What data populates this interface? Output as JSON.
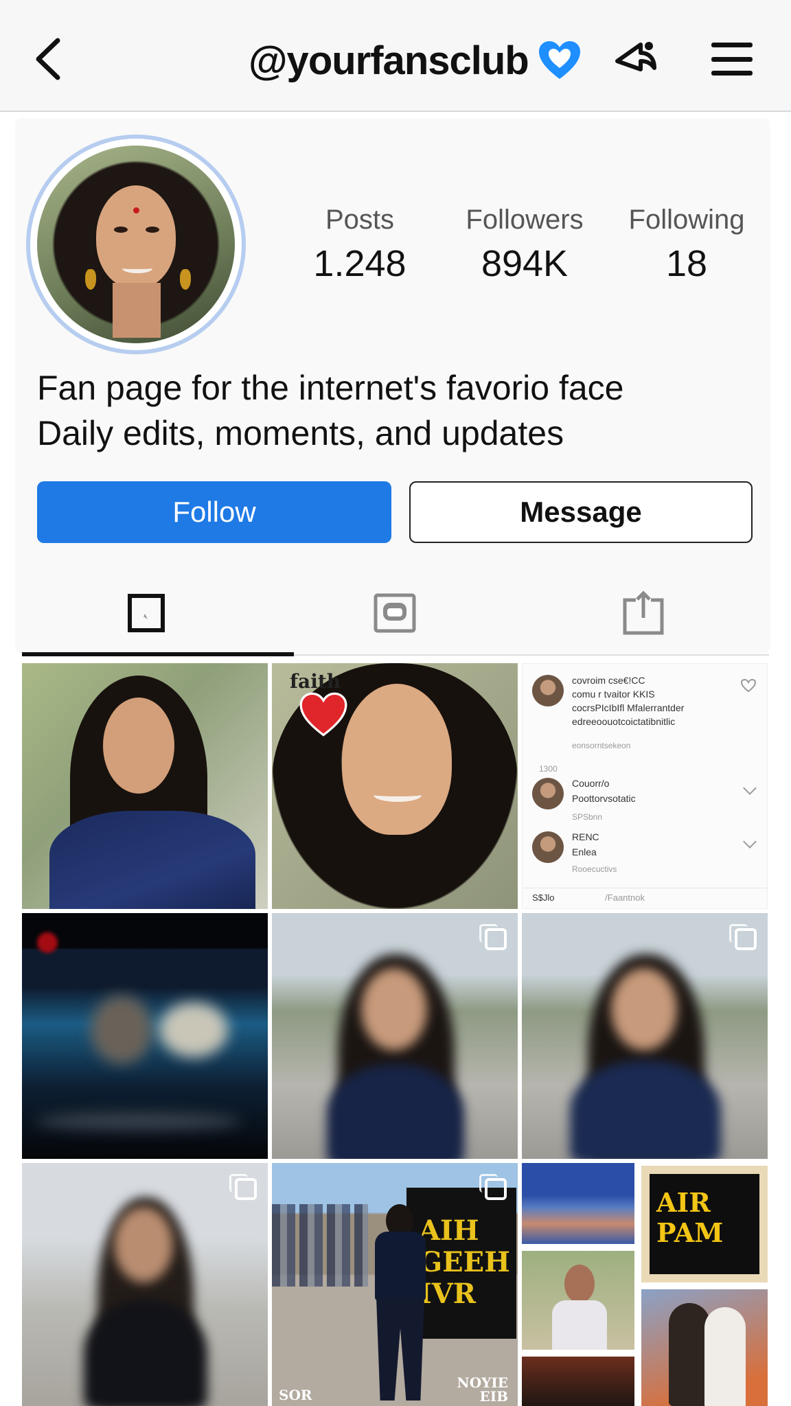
{
  "header": {
    "username": "@yourfansclub",
    "back_icon": "chevron-left-icon",
    "verified_icon": "blue-heart-icon",
    "share_icon": "share-icon",
    "menu_icon": "hamburger-menu-icon"
  },
  "profile": {
    "stats": [
      {
        "label": "Posts",
        "value": "1.248"
      },
      {
        "label": "Followers",
        "value": "894K"
      },
      {
        "label": "Following",
        "value": "18"
      }
    ],
    "bio": {
      "line1": "Fan page for the internet's favorio face",
      "line2": "Daily edits, moments, and updates"
    },
    "follow_label": "Follow",
    "message_label": "Message"
  },
  "tabs": [
    {
      "icon": "grid-icon",
      "active": true
    },
    {
      "icon": "reels-icon",
      "active": false
    },
    {
      "icon": "tagged-icon",
      "active": false
    }
  ],
  "grid": {
    "post2_tag": "faith",
    "post3": {
      "comments": [
        {
          "line1": "covroim cse€!CC",
          "line2": "comu r tvaitor KKIS",
          "line3": "cocrsPIcIbIfl Mfalerrantder",
          "line4": "edreeoouotcoictatibnitlic",
          "meta": "eonsorntsekeon",
          "count": "1300"
        },
        {
          "line1": "Couorr/o",
          "line2": "Poottorvsotatic",
          "meta": "SPSbnn"
        },
        {
          "line1": "RENC",
          "line2": "Enlea",
          "meta": "Rooecuctivs"
        }
      ],
      "footer_left": "S$Jlo",
      "footer_mid": "/Faantnok"
    },
    "post8": {
      "sign": "AIH\nGEEH\nIVR",
      "caption_left": "SOR",
      "caption_right": "NOYIE\nEIB"
    },
    "post9": {
      "sign": "AIR\nPAM"
    }
  },
  "colors": {
    "accent": "#1f7ae6",
    "verified": "#1f8fff",
    "heart": "#e0262b"
  }
}
